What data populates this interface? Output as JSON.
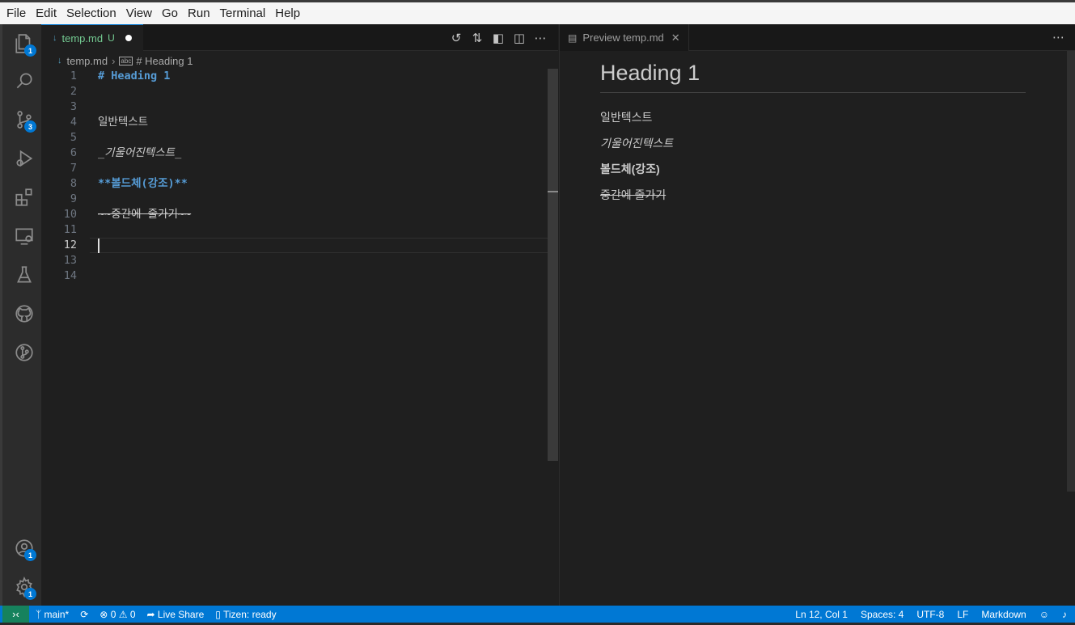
{
  "menu": [
    "File",
    "Edit",
    "Selection",
    "View",
    "Go",
    "Run",
    "Terminal",
    "Help"
  ],
  "activity": {
    "explorer_badge": "1",
    "scm_badge": "3",
    "accounts_badge": "1",
    "settings_badge": "1"
  },
  "left_editor": {
    "tab": {
      "title": "temp.md",
      "status": "U"
    },
    "breadcrumb": {
      "file": "temp.md",
      "symbol": "# Heading 1"
    },
    "lines": [
      {
        "n": "1",
        "text": "# Heading 1"
      },
      {
        "n": "2",
        "text": ""
      },
      {
        "n": "3",
        "text": ""
      },
      {
        "n": "4",
        "text": "일반텍스트"
      },
      {
        "n": "5",
        "text": ""
      },
      {
        "n": "6",
        "text": "_기울어진텍스트_"
      },
      {
        "n": "7",
        "text": ""
      },
      {
        "n": "8",
        "text": "**볼드체(강조)**"
      },
      {
        "n": "9",
        "text": ""
      },
      {
        "n": "10",
        "text": "~~중간에 줄가기~~"
      },
      {
        "n": "11",
        "text": ""
      },
      {
        "n": "12",
        "text": ""
      },
      {
        "n": "13",
        "text": ""
      },
      {
        "n": "14",
        "text": ""
      }
    ]
  },
  "right_editor": {
    "tab": {
      "title": "Preview temp.md"
    },
    "preview": {
      "h1": "Heading 1",
      "p1": "일반텍스트",
      "p2": "기울어진텍스트",
      "p3": "볼드체(강조)",
      "p4": "중간에 줄가기"
    }
  },
  "status": {
    "branch": "main*",
    "errors": "0",
    "warnings": "0",
    "live_share": "Live Share",
    "tizen": "Tizen: ready",
    "position": "Ln 12, Col 1",
    "spaces": "Spaces: 4",
    "encoding": "UTF-8",
    "eol": "LF",
    "language": "Markdown"
  },
  "colors": {
    "accent": "#0078d4",
    "untracked": "#73c991",
    "heading_syntax": "#569cd6"
  }
}
